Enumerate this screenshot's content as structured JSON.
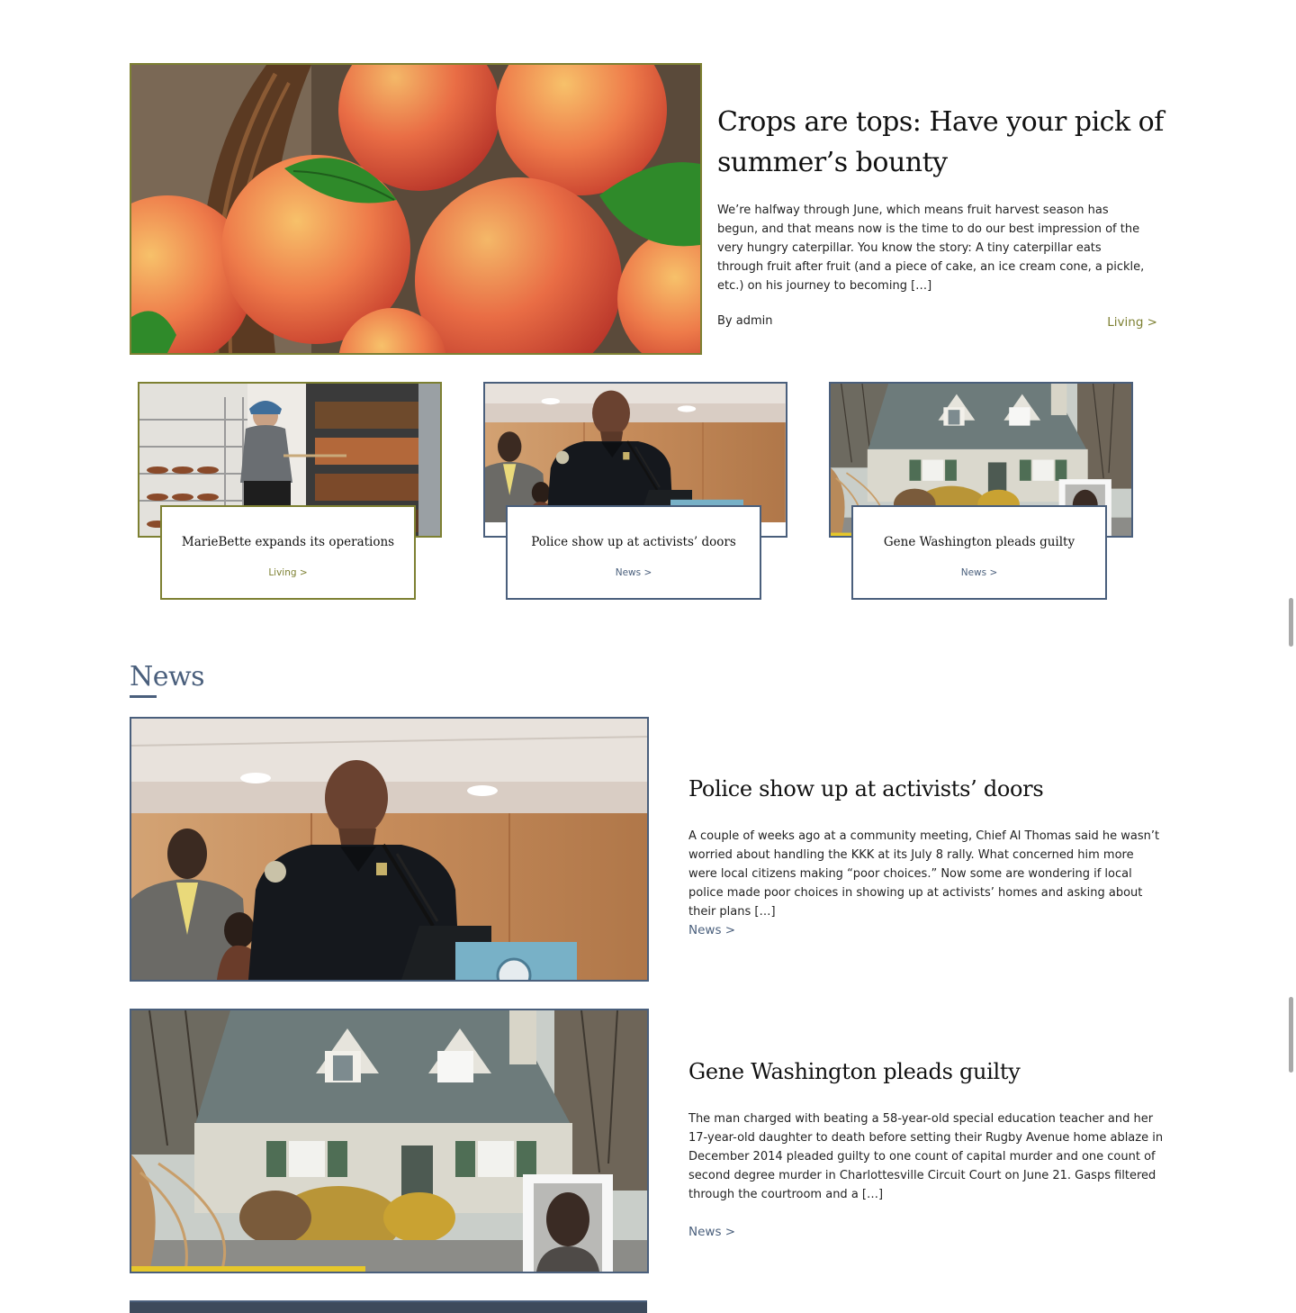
{
  "featured": {
    "title": "Crops are tops: Have your pick of summer’s bounty",
    "excerpt": "We’re halfway through June, which means fruit harvest season has begun, and that means now is the time to do our best impression of the very hungry caterpillar. You know the story: A tiny caterpillar eats through fruit after fruit (and a piece of cake, an ice cream cone, a pickle, etc.) on his journey to becoming […]",
    "author": "By admin",
    "category": "Living >",
    "image": "peaches-in-basket"
  },
  "cards": [
    {
      "title": "MarieBette expands its operations",
      "category": "Living >",
      "image": "bakery-oven"
    },
    {
      "title": "Police show up at activists’ doors",
      "category": "News >",
      "image": "police-chief-podium"
    },
    {
      "title": "Gene Washington pleads guilty",
      "category": "News >",
      "image": "burned-house-mugshot"
    }
  ],
  "news_section": {
    "heading": "News",
    "items": [
      {
        "title": "Police show up at activists’ doors",
        "excerpt": "A couple of weeks ago at a community meeting, Chief Al Thomas said he wasn’t worried about handling the KKK at its July 8 rally. What concerned him more were local citizens making “poor choices.” Now some are wondering if local police made poor choices in showing up at activists’ homes and asking about their plans […]",
        "category": "News >",
        "image": "police-chief-podium"
      },
      {
        "title": "Gene Washington pleads guilty",
        "excerpt": "The man charged with beating a 58-year-old special education teacher and her 17-year-old daughter to death before setting their Rugby Avenue home ablaze in December 2014 pleaded guilty to one count of capital murder and one count of second degree murder in Charlottesville Circuit Court on June 21. Gasps filtered through the courtroom and a […]",
        "category": "News >",
        "image": "burned-house-mugshot"
      }
    ]
  },
  "colors": {
    "living": "#7d8032",
    "news": "#4a5f7c"
  }
}
